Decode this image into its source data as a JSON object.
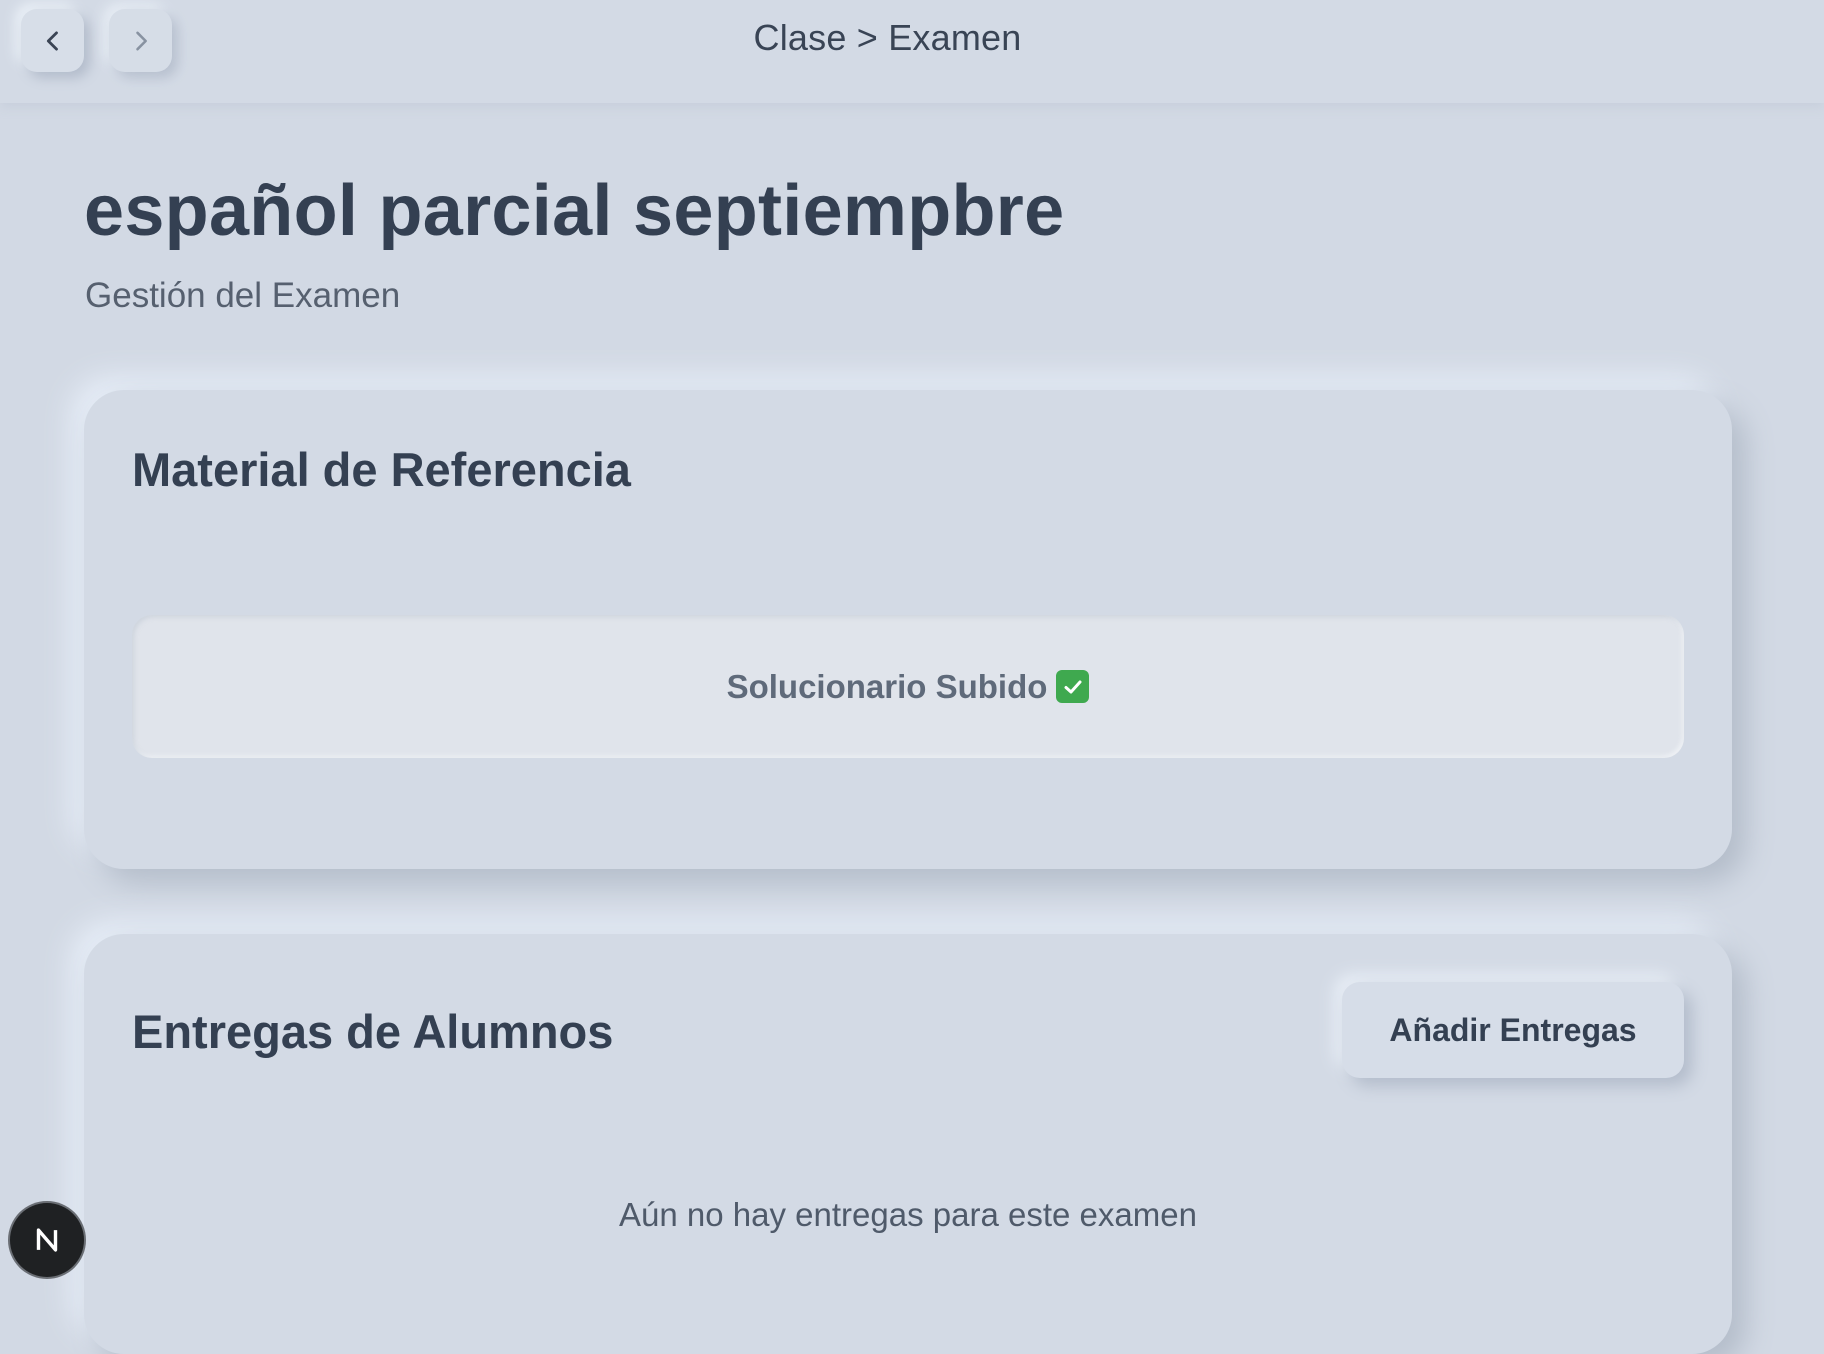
{
  "nav": {
    "back_icon": "chevron-left-icon",
    "forward_icon": "chevron-right-icon"
  },
  "breadcrumb": "Clase > Examen",
  "page": {
    "title": "español parcial septiempbre",
    "subtitle": "Gestión del Examen"
  },
  "reference_card": {
    "title": "Material de Referencia",
    "status_text": "Solucionario Subido",
    "status_icon": "check-mark-icon",
    "status_color": "#3fa94f"
  },
  "submissions_card": {
    "title": "Entregas de Alumnos",
    "add_button_label": "Añadir Entregas",
    "empty_message": "Aún no hay entregas para este examen"
  },
  "dev_badge": {
    "label": "N"
  },
  "colors": {
    "background": "#d2d9e4",
    "text_primary": "#344052",
    "badge_background": "#1f2123"
  }
}
